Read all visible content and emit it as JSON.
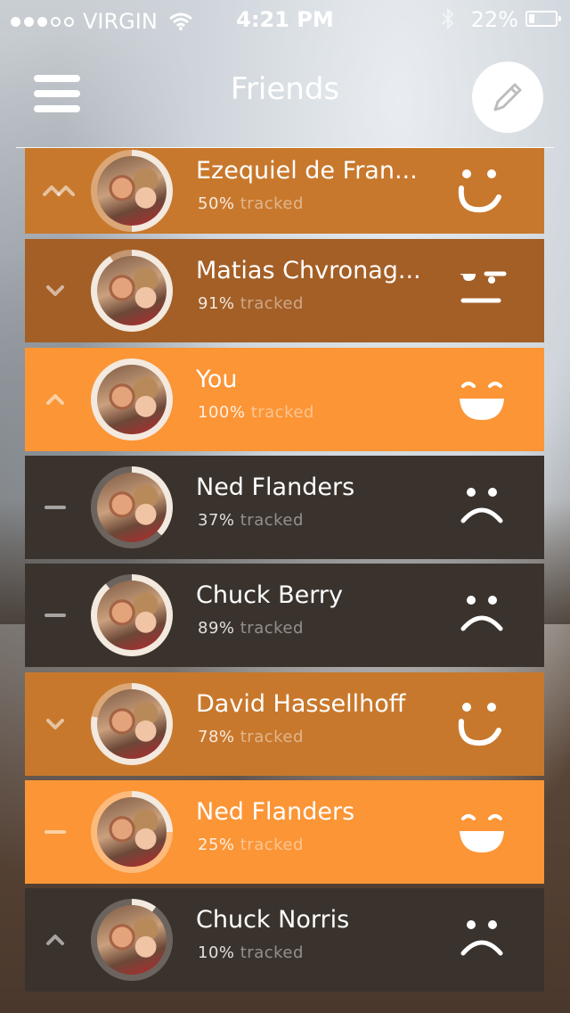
{
  "status_bar": {
    "carrier": "VIRGIN",
    "time": "4:21 PM",
    "battery": "22%"
  },
  "header": {
    "title": "Friends"
  },
  "colors": {
    "orange_bright": "#fb9536",
    "orange_mid": "#c8782c",
    "orange_dark": "#a45f26",
    "charcoal": "#3a332d"
  },
  "friends": [
    {
      "name": "Ezequiel de Fran...",
      "percent": "50%",
      "tracked_label": "tracked",
      "mood": "wink",
      "chevron": "double-up",
      "color": "orange_mid"
    },
    {
      "name": "Matias Chvronag...",
      "percent": "91%",
      "tracked_label": "tracked",
      "mood": "skeptical",
      "chevron": "down",
      "color": "orange_dark"
    },
    {
      "name": "You",
      "percent": "100%",
      "tracked_label": "tracked",
      "mood": "laugh",
      "chevron": "up",
      "color": "orange_bright"
    },
    {
      "name": "Ned Flanders",
      "percent": "37%",
      "tracked_label": "tracked",
      "mood": "sad",
      "chevron": "dash",
      "color": "charcoal"
    },
    {
      "name": "Chuck Berry",
      "percent": "89%",
      "tracked_label": "tracked",
      "mood": "sad",
      "chevron": "dash",
      "color": "charcoal"
    },
    {
      "name": "David Hassellhoff",
      "percent": "78%",
      "tracked_label": "tracked",
      "mood": "wink",
      "chevron": "down",
      "color": "orange_mid"
    },
    {
      "name": "Ned Flanders",
      "percent": "25%",
      "tracked_label": "tracked",
      "mood": "laugh",
      "chevron": "dash",
      "color": "orange_bright"
    },
    {
      "name": "Chuck Norris",
      "percent": "10%",
      "tracked_label": "tracked",
      "mood": "sad",
      "chevron": "up",
      "color": "charcoal"
    }
  ]
}
